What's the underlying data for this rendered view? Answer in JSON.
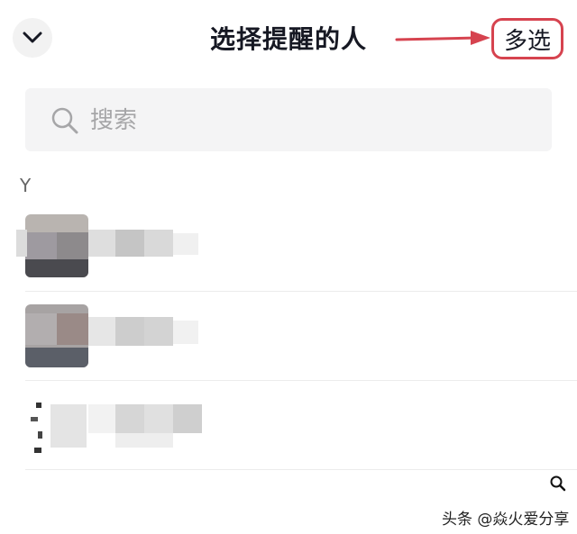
{
  "header": {
    "title": "选择提醒的人",
    "multi_select_label": "多选",
    "back_icon": "chevron-down-icon",
    "accent_color": "#d6434f"
  },
  "search": {
    "placeholder": "搜索",
    "value": "",
    "icon": "search-icon"
  },
  "contacts": {
    "section_letter": "Y",
    "items": [
      {
        "avatar": "blurred-avatar",
        "name_hidden": true
      },
      {
        "avatar": "blurred-avatar",
        "name_hidden": true
      },
      {
        "avatar": "blurred-avatar",
        "name_hidden": true
      }
    ]
  },
  "watermark": {
    "text": "头条 @焱火爱分享",
    "icon": "search-icon"
  }
}
